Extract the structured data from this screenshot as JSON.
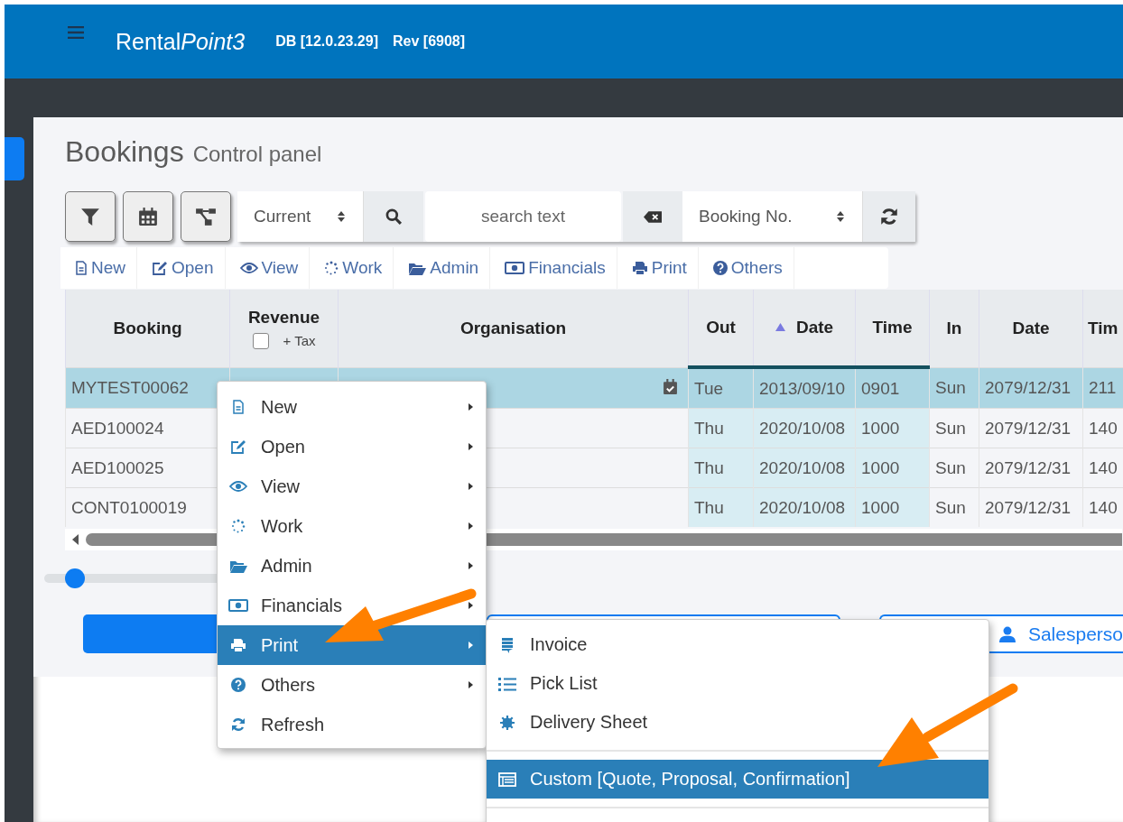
{
  "header": {
    "brand": "Rental",
    "brand_accent": "Point3",
    "db_version": "DB [12.0.23.29]",
    "revision": "Rev [6908]"
  },
  "page": {
    "title": "Bookings",
    "subtitle": "Control panel"
  },
  "toolbar": {
    "status_select": "Current",
    "search": {
      "placeholder": "search text"
    },
    "sort_select": "Booking No."
  },
  "actions": [
    {
      "label": "New"
    },
    {
      "label": "Open"
    },
    {
      "label": "View"
    },
    {
      "label": "Work"
    },
    {
      "label": "Admin"
    },
    {
      "label": "Financials"
    },
    {
      "label": "Print"
    },
    {
      "label": "Others"
    }
  ],
  "table": {
    "columns": [
      {
        "label": "Booking",
        "highlighted": false
      },
      {
        "label": "Revenue",
        "highlighted": false,
        "tax_checkbox": {
          "label": "+ Tax",
          "checked": false
        }
      },
      {
        "label": "Organisation",
        "highlighted": false
      },
      {
        "label": "Out",
        "highlighted": true
      },
      {
        "label": "Date",
        "highlighted": true,
        "sorted_ascending": true
      },
      {
        "label": "Time",
        "highlighted": true
      },
      {
        "label": "In",
        "highlighted": false
      },
      {
        "label": "Date",
        "highlighted": false
      },
      {
        "label": "Tim",
        "highlighted": false
      }
    ],
    "rows": [
      {
        "selected": true,
        "scheduled": true,
        "booking": "MYTEST00062",
        "out": "Tue",
        "out_date": "2013/09/10",
        "out_time": "0901",
        "in": "Sun",
        "in_date": "2079/12/31",
        "in_time": "211"
      },
      {
        "selected": false,
        "scheduled": false,
        "booking": "AED100024",
        "out": "Thu",
        "out_date": "2020/10/08",
        "out_time": "1000",
        "in": "Sun",
        "in_date": "2079/12/31",
        "in_time": "140"
      },
      {
        "selected": false,
        "scheduled": false,
        "booking": "AED100025",
        "out": "Thu",
        "out_date": "2020/10/08",
        "out_time": "1000",
        "in": "Sun",
        "in_date": "2079/12/31",
        "in_time": "140"
      },
      {
        "selected": false,
        "scheduled": false,
        "booking": "CONT0100019",
        "out": "Thu",
        "out_date": "2020/10/08",
        "out_time": "1000",
        "in": "Sun",
        "in_date": "2079/12/31",
        "in_time": "140"
      }
    ]
  },
  "zoom_slider": {
    "level": 0.07
  },
  "salesperson_button": {
    "label": "Salesperso"
  },
  "context_menu": {
    "items": [
      {
        "label": "New",
        "selected": false,
        "submenu": true
      },
      {
        "label": "Open",
        "selected": false,
        "submenu": true
      },
      {
        "label": "View",
        "selected": false,
        "submenu": true
      },
      {
        "label": "Work",
        "selected": false,
        "submenu": true
      },
      {
        "label": "Admin",
        "selected": false,
        "submenu": true
      },
      {
        "label": "Financials",
        "selected": false,
        "submenu": true
      },
      {
        "label": "Print",
        "selected": true,
        "submenu": true
      },
      {
        "label": "Others",
        "selected": false,
        "submenu": true
      },
      {
        "label": "Refresh",
        "selected": false,
        "submenu": false
      }
    ]
  },
  "print_submenu": {
    "items": [
      {
        "kind": "item",
        "label": "Invoice",
        "selected": false
      },
      {
        "kind": "item",
        "label": "Pick List",
        "selected": false
      },
      {
        "kind": "item",
        "label": "Delivery Sheet",
        "selected": false
      },
      {
        "kind": "divider"
      },
      {
        "kind": "item",
        "label": "Custom [Quote, Proposal, Confirmation]",
        "selected": true
      },
      {
        "kind": "divider"
      }
    ]
  }
}
